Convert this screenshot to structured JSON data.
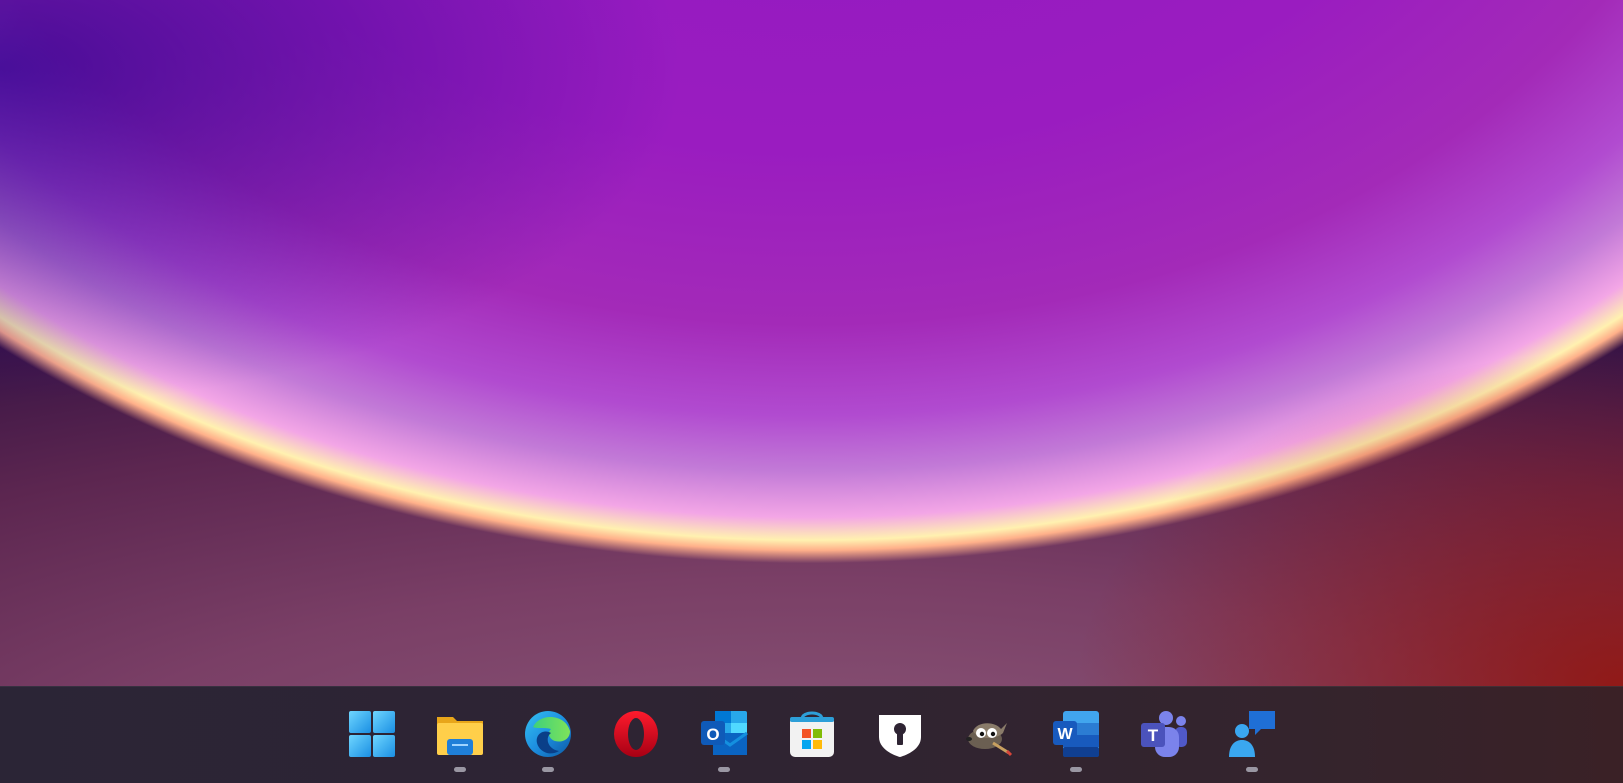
{
  "wallpaper": {
    "colors": {
      "sphere_top": "#9a1cc0",
      "rim_glow": "#fff1b0",
      "rim_orange": "#ff7a5a",
      "corner_left": "#2800a0",
      "corner_right": "#961408"
    }
  },
  "taskbar": {
    "background": "#2e2433",
    "indicator_color": "#9a97a3",
    "items": [
      {
        "icon": "windows-start-icon",
        "running": false
      },
      {
        "icon": "file-explorer-icon",
        "running": true
      },
      {
        "icon": "edge-browser-icon",
        "running": true
      },
      {
        "icon": "opera-browser-icon",
        "running": false
      },
      {
        "icon": "outlook-icon",
        "letter": "O",
        "running": true
      },
      {
        "icon": "microsoft-store-icon",
        "running": false
      },
      {
        "icon": "bitwarden-icon",
        "running": false
      },
      {
        "icon": "gimp-icon",
        "running": false
      },
      {
        "icon": "word-icon",
        "letter": "W",
        "running": true
      },
      {
        "icon": "teams-icon",
        "letter": "T",
        "running": false
      },
      {
        "icon": "people-chat-icon",
        "running": true
      }
    ]
  }
}
